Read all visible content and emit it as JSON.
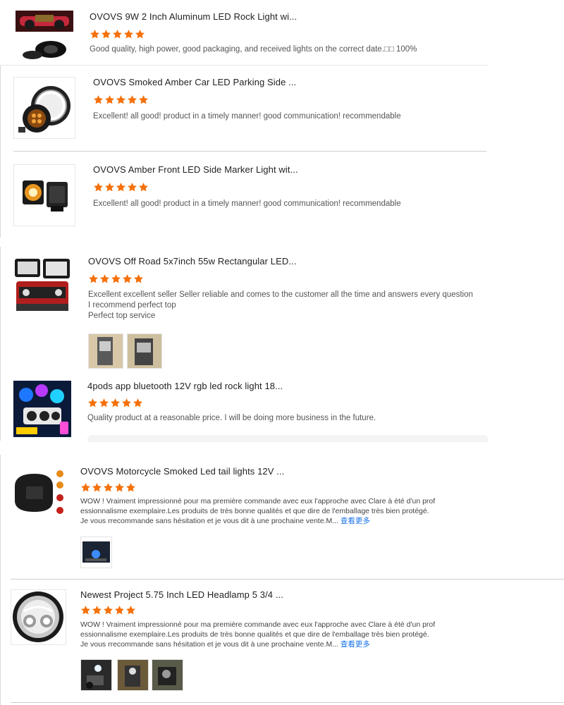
{
  "reviews": [
    {
      "title": "OVOVS 9W 2 Inch Aluminum LED Rock Light wi...",
      "rating": 5,
      "text": "Good quality, high power, good packaging, and received lights on the correct date.□□ 100%"
    },
    {
      "title": "OVOVS Smoked Amber Car LED Parking Side ...",
      "rating": 5,
      "text": "Excellent! all good! product in a timely manner! good communication! recommendable"
    },
    {
      "title": "OVOVS Amber Front LED Side Marker Light wit...",
      "rating": 5,
      "text": "Excellent! all good! product in a timely manner! good communication! recommendable"
    },
    {
      "title": "OVOVS Off Road 5x7inch 55w Rectangular LED...",
      "rating": 5,
      "text_lines": [
        "Excellent excellent seller Seller reliable and comes to the customer all the time and answers every question",
        "I recommend perfect top",
        "Perfect top service"
      ]
    },
    {
      "title": "4pods app bluetooth 12V rgb led rock light 18...",
      "rating": 5,
      "text": "Quality product at a reasonable price. I will be doing more business in the future."
    },
    {
      "title": "OVOVS Motorcycle Smoked Led tail lights 12V ...",
      "rating": 5,
      "text_lines": [
        "WOW ! Vraiment impressionné pour ma première commande avec eux l'approche avec Clare à été d'un prof",
        "essionnalisme exemplaire.Les produits de très bonne qualités et que dire de l'emballage très bien protégé.",
        "Je vous rrecommande sans hésitation et je vous dit à une prochaine vente.M..."
      ],
      "more": "查看更多"
    },
    {
      "title": "Newest Project 5.75 Inch LED Headlamp 5 3/4 ...",
      "rating": 5,
      "text_lines": [
        "WOW ! Vraiment impressionné pour ma première commande avec eux l'approche avec Clare à été d'un prof",
        "essionnalisme exemplaire.Les produits de très bonne qualités et que dire de l'emballage très bien protégé.",
        "Je vous rrecommande sans hésitation et je vous dit à une prochaine vente.M..."
      ],
      "more": "查看更多"
    }
  ],
  "colors": {
    "star": "#f5700a",
    "link": "#1a73e8"
  }
}
